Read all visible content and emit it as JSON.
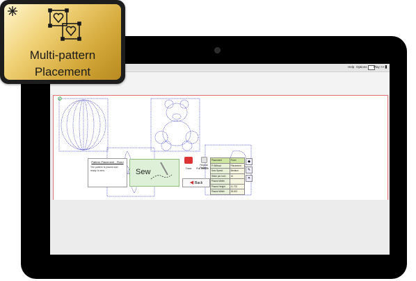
{
  "badge": {
    "line1": "Multi-pattern",
    "line2": "Placement",
    "icons": [
      "sparkle-icon",
      "heart-frame-icon",
      "heart-frame-icon"
    ]
  },
  "topbar": {
    "help_label": "Help",
    "options_label": "Options",
    "play_label": "Play >>"
  },
  "dialog": {
    "title": "Pattern Placement - Fixed",
    "text": "The pattern is placed and ready to sew."
  },
  "sew": {
    "label": "Sew"
  },
  "side": {
    "top_label": "Repeat Pattern",
    "mid_left_label": "Trace",
    "mid_right_label": "Pull Bobbin",
    "back_label": "Back"
  },
  "info_rows": [
    {
      "label": "Placement",
      "value": "Fixed"
    },
    {
      "label": "P-Without",
      "value": "Placement"
    },
    {
      "label": "Sew Speed",
      "value": "Medium"
    },
    {
      "label": "Stitch per Inch",
      "value": "10"
    },
    {
      "label": "Placed Width",
      "value": ""
    },
    {
      "label": "Placed Height",
      "value": "11.702"
    },
    {
      "label": "Placed Width",
      "value": "28.821"
    }
  ],
  "colors": {
    "accent_red": "#e57373",
    "pattern_blue": "#4a4acc",
    "sew_green": "#dff0d8",
    "badge_gold": "#d4a83a"
  },
  "canvas_patterns": [
    "ball-pattern",
    "teddy-bear-pattern",
    "pinwheel-pattern",
    "butterfly-pattern"
  ]
}
